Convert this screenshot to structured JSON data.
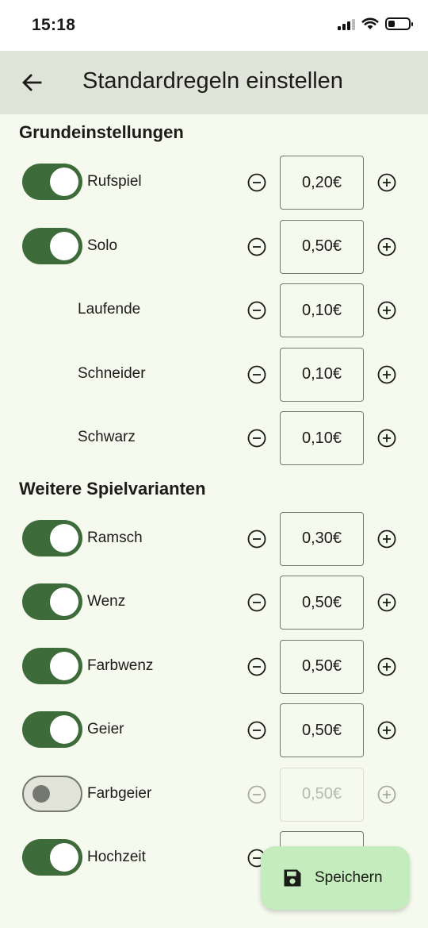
{
  "status": {
    "time": "15:18"
  },
  "app_bar": {
    "title": "Standardregeln einstellen"
  },
  "sections": {
    "basic_title": "Grundeinstellungen",
    "more_title": "Weitere Spielvarianten"
  },
  "basic_rows": [
    {
      "label": "Rufspiel",
      "value": "0,20€",
      "toggle": true,
      "enabled": true
    },
    {
      "label": "Solo",
      "value": "0,50€",
      "toggle": true,
      "enabled": true
    },
    {
      "label": "Laufende",
      "value": "0,10€",
      "toggle": null,
      "enabled": true
    },
    {
      "label": "Schneider",
      "value": "0,10€",
      "toggle": null,
      "enabled": true
    },
    {
      "label": "Schwarz",
      "value": "0,10€",
      "toggle": null,
      "enabled": true
    }
  ],
  "more_rows": [
    {
      "label": "Ramsch",
      "value": "0,30€",
      "toggle": true,
      "enabled": true
    },
    {
      "label": "Wenz",
      "value": "0,50€",
      "toggle": true,
      "enabled": true
    },
    {
      "label": "Farbwenz",
      "value": "0,50€",
      "toggle": true,
      "enabled": true
    },
    {
      "label": "Geier",
      "value": "0,50€",
      "toggle": true,
      "enabled": true
    },
    {
      "label": "Farbgeier",
      "value": "0,50€",
      "toggle": false,
      "enabled": false
    },
    {
      "label": "Hochzeit",
      "value": "",
      "toggle": true,
      "enabled": true
    }
  ],
  "fab": {
    "label": "Speichern",
    "icon": "save-icon"
  },
  "colors": {
    "accent": "#3e6b3a",
    "fab_bg": "#c4ecbd",
    "app_bar_bg": "#dfe3d8",
    "page_bg": "#f6f9ee"
  }
}
